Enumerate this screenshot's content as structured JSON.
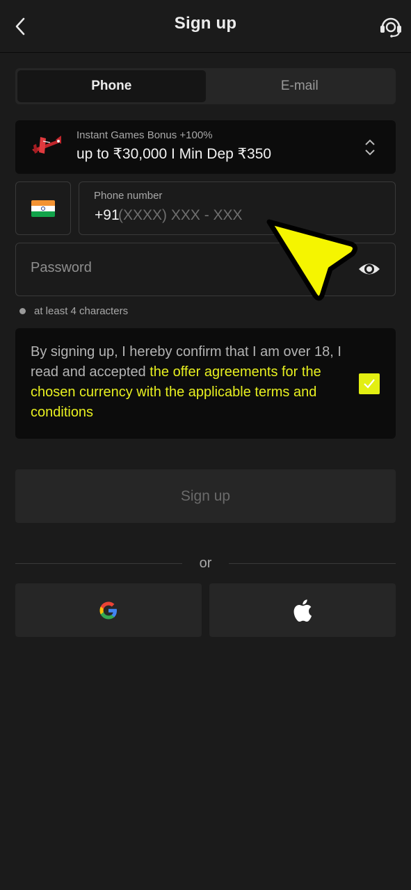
{
  "header": {
    "title": "Sign up",
    "back_icon": "chevron-left-icon",
    "support_icon": "headset-support-icon"
  },
  "tabs": [
    {
      "label": "Phone",
      "active": true
    },
    {
      "label": "E-mail",
      "active": false
    }
  ],
  "bonus": {
    "subtitle": "Instant Games Bonus +100%",
    "title": "up to ₹30,000 I Min Dep ₹350",
    "icon": "airplane-icon"
  },
  "phone": {
    "country_flag": "india-flag-icon",
    "label": "Phone number",
    "prefix": "+91",
    "mask": "(XXXX) XXX - XXX"
  },
  "password": {
    "placeholder": "Password",
    "hint": "at least 4 characters"
  },
  "terms": {
    "text": "By signing up, I hereby confirm that I am over 18, I read and accepted ",
    "link": "the offer agreements for the chosen currency with the applicable terms and conditions",
    "checked": true
  },
  "signup_button": "Sign up",
  "divider": "or",
  "social": [
    "google",
    "apple"
  ],
  "colors": {
    "accent": "#e3ef12",
    "background": "#1b1b1b"
  }
}
